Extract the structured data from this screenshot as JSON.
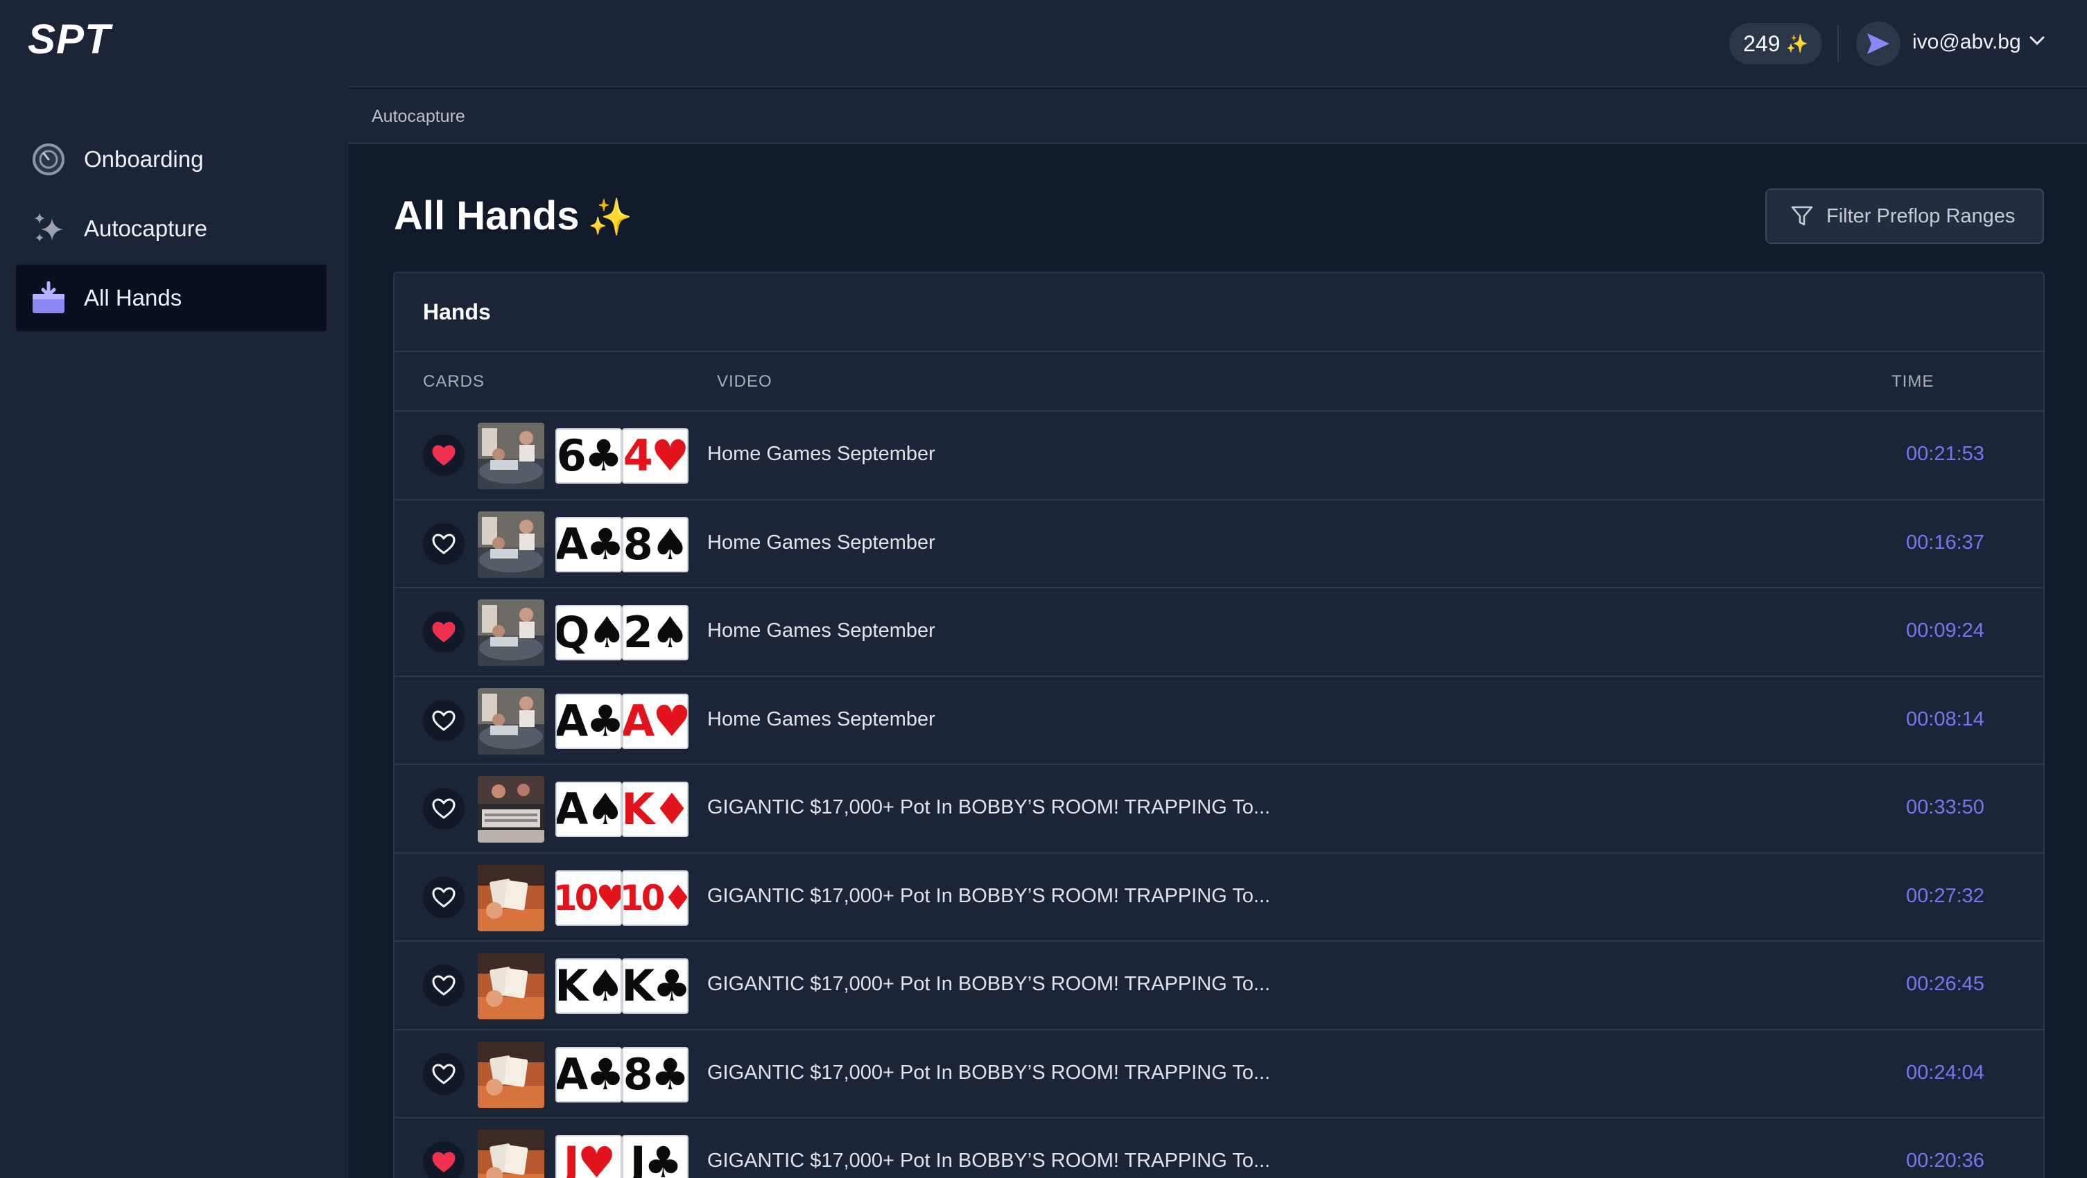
{
  "app": {
    "logo": "SPT"
  },
  "sidebar": {
    "items": [
      {
        "label": "Onboarding",
        "icon": "onboarding-icon",
        "active": false
      },
      {
        "label": "Autocapture",
        "icon": "sparkles-icon",
        "active": false
      },
      {
        "label": "All Hands",
        "icon": "inbox-icon",
        "active": true
      }
    ]
  },
  "topbar": {
    "credits": "249",
    "credits_icon": "sparkles-icon",
    "user_email": "ivo@abv.bg"
  },
  "breadcrumb": "Autocapture",
  "page": {
    "title": "All Hands",
    "filter_label": "Filter Preflop Ranges"
  },
  "table": {
    "title": "Hands",
    "columns": {
      "cards": "CARDS",
      "video": "VIDEO",
      "time": "TIME"
    },
    "rows": [
      {
        "liked": true,
        "cards": [
          {
            "rank": "6",
            "suit": "♣",
            "color": "black"
          },
          {
            "rank": "4",
            "suit": "♥",
            "color": "red"
          }
        ],
        "video": "Home Games September",
        "time": "00:21:53",
        "thumb": "home"
      },
      {
        "liked": false,
        "cards": [
          {
            "rank": "A",
            "suit": "♣",
            "color": "black"
          },
          {
            "rank": "8",
            "suit": "♠",
            "color": "black"
          }
        ],
        "video": "Home Games September",
        "time": "00:16:37",
        "thumb": "home"
      },
      {
        "liked": true,
        "cards": [
          {
            "rank": "Q",
            "suit": "♠",
            "color": "black"
          },
          {
            "rank": "2",
            "suit": "♠",
            "color": "black"
          }
        ],
        "video": "Home Games September",
        "time": "00:09:24",
        "thumb": "home"
      },
      {
        "liked": false,
        "cards": [
          {
            "rank": "A",
            "suit": "♣",
            "color": "black"
          },
          {
            "rank": "A",
            "suit": "♥",
            "color": "red"
          }
        ],
        "video": "Home Games September",
        "time": "00:08:14",
        "thumb": "home"
      },
      {
        "liked": false,
        "cards": [
          {
            "rank": "A",
            "suit": "♠",
            "color": "black"
          },
          {
            "rank": "K",
            "suit": "♦",
            "color": "red"
          }
        ],
        "video": "GIGANTIC $17,000+ Pot In BOBBY’S ROOM! TRAPPING To...",
        "time": "00:33:50",
        "thumb": "studio"
      },
      {
        "liked": false,
        "cards": [
          {
            "rank": "10",
            "suit": "♥",
            "color": "red"
          },
          {
            "rank": "10",
            "suit": "♦",
            "color": "red"
          }
        ],
        "video": "GIGANTIC $17,000+ Pot In BOBBY’S ROOM! TRAPPING To...",
        "time": "00:27:32",
        "thumb": "table"
      },
      {
        "liked": false,
        "cards": [
          {
            "rank": "K",
            "suit": "♠",
            "color": "black"
          },
          {
            "rank": "K",
            "suit": "♣",
            "color": "black"
          }
        ],
        "video": "GIGANTIC $17,000+ Pot In BOBBY’S ROOM! TRAPPING To...",
        "time": "00:26:45",
        "thumb": "table"
      },
      {
        "liked": false,
        "cards": [
          {
            "rank": "A",
            "suit": "♣",
            "color": "black"
          },
          {
            "rank": "8",
            "suit": "♣",
            "color": "black"
          }
        ],
        "video": "GIGANTIC $17,000+ Pot In BOBBY’S ROOM! TRAPPING To...",
        "time": "00:24:04",
        "thumb": "table"
      },
      {
        "liked": true,
        "cards": [
          {
            "rank": "J",
            "suit": "♥",
            "color": "red"
          },
          {
            "rank": "J",
            "suit": "♣",
            "color": "black"
          }
        ],
        "video": "GIGANTIC $17,000+ Pot In BOBBY’S ROOM! TRAPPING To...",
        "time": "00:20:36",
        "thumb": "table"
      }
    ]
  },
  "colors": {
    "accent": "#7b74f0",
    "heart_liked": "#f0304f",
    "sidebar_bg": "#1c2537",
    "page_bg": "#111a2b"
  }
}
